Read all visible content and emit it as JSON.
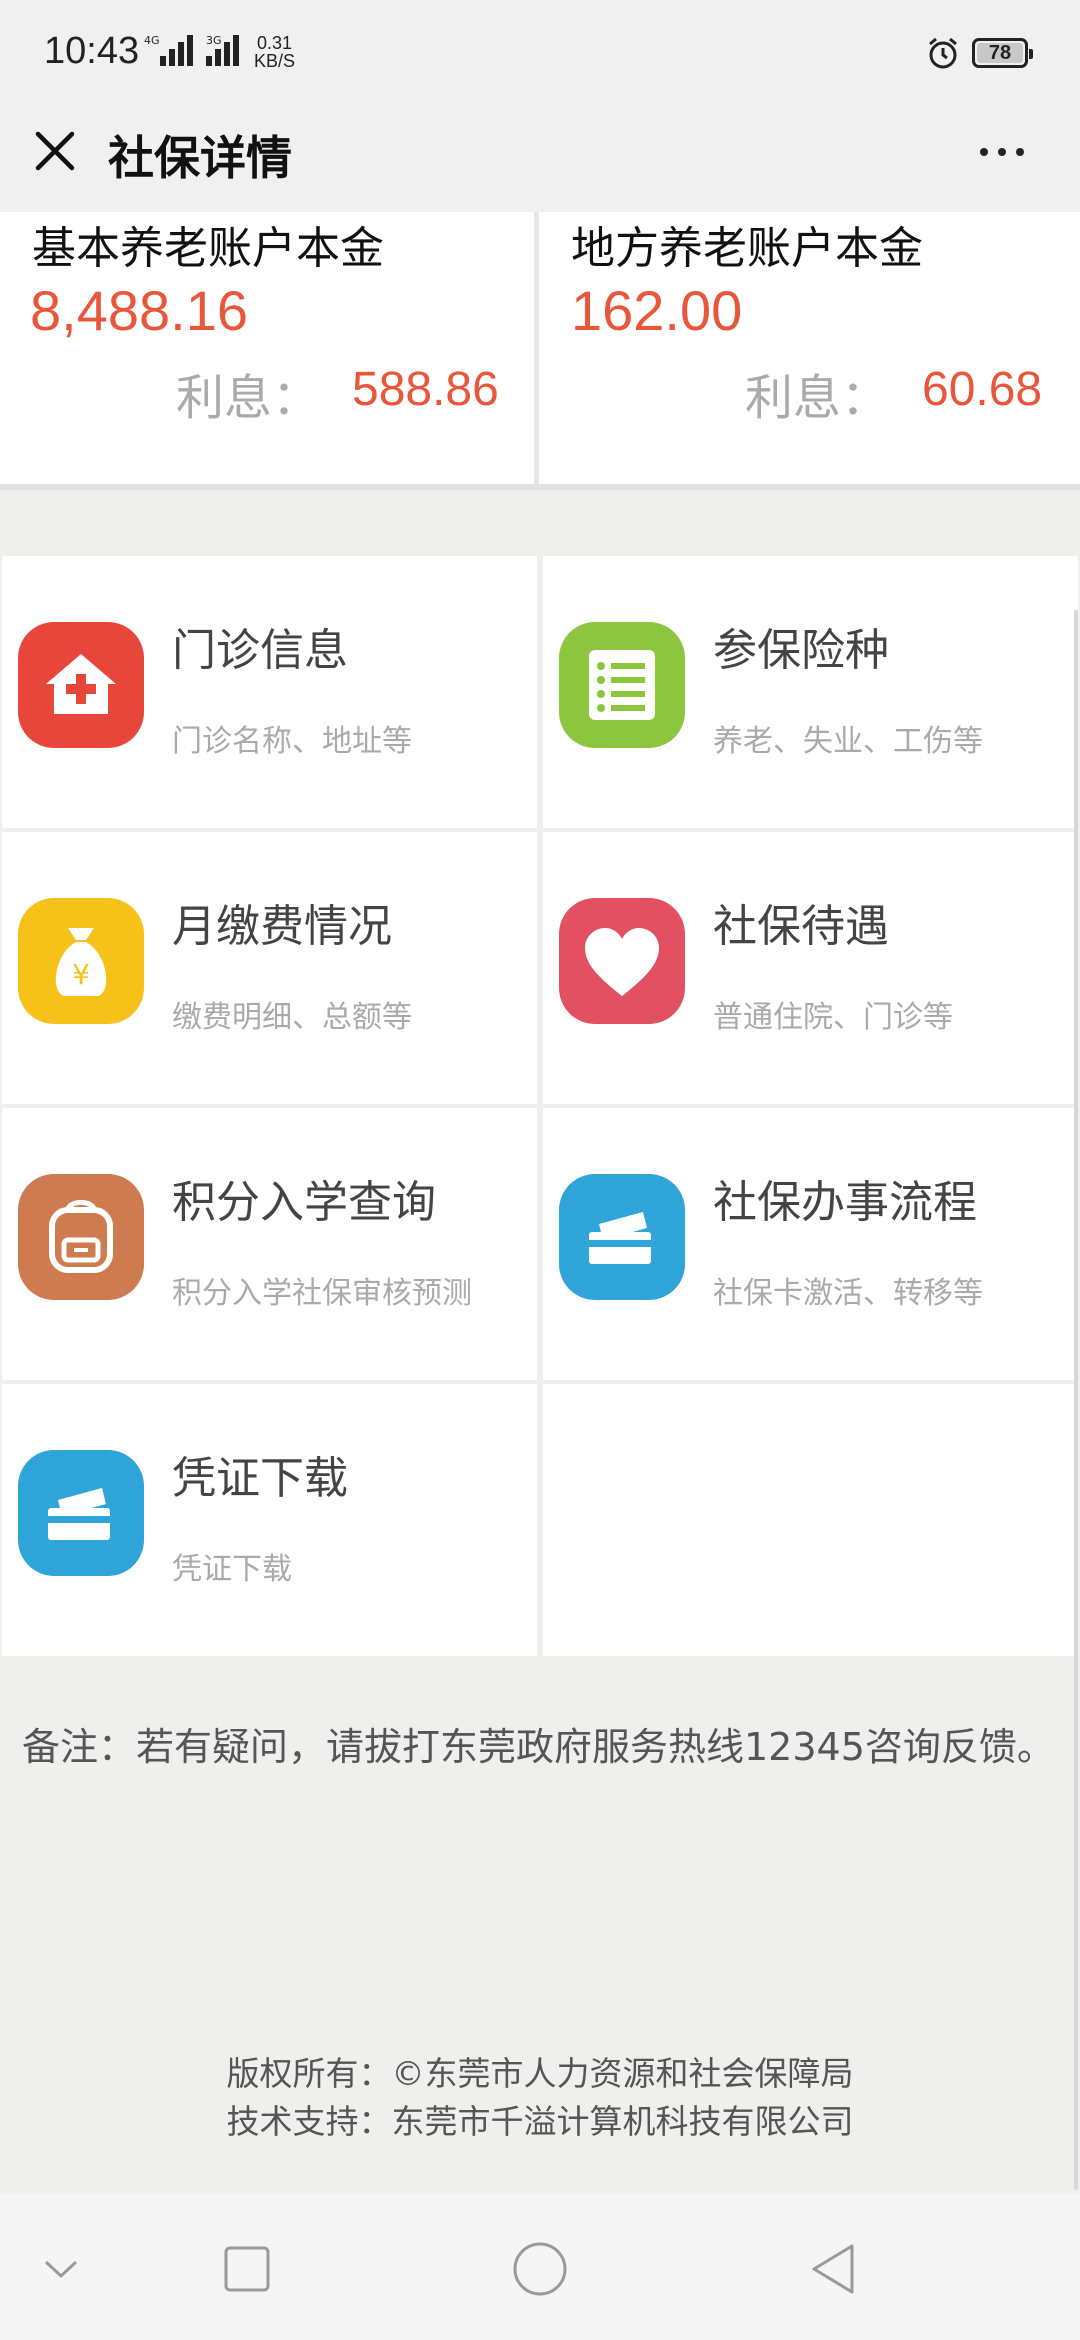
{
  "status_bar": {
    "time": "10:43",
    "signal1_label": "4G",
    "signal2_label": "3G",
    "net_speed_value": "0.31",
    "net_speed_unit": "KB/S",
    "battery": "78",
    "icons": [
      "signal-icon",
      "alarm-icon",
      "battery-icon"
    ]
  },
  "header": {
    "title": "社保详情",
    "close_icon": "close-icon",
    "more_icon": "more-icon"
  },
  "accounts": [
    {
      "title": "基本养老账户本金",
      "amount": "8,488.16",
      "interest_label": "利息：",
      "interest": "588.86"
    },
    {
      "title": "地方养老账户本金",
      "amount": "162.00",
      "interest_label": "利息：",
      "interest": "60.68"
    }
  ],
  "menu": [
    {
      "title": "门诊信息",
      "subtitle": "门诊名称、地址等",
      "icon": "clinic-icon",
      "color": "#e8453b"
    },
    {
      "title": "参保险种",
      "subtitle": "养老、失业、工伤等",
      "icon": "list-icon",
      "color": "#8cc63f"
    },
    {
      "title": "月缴费情况",
      "subtitle": "缴费明细、总额等",
      "icon": "money-bag-icon",
      "color": "#f6c21a"
    },
    {
      "title": "社保待遇",
      "subtitle": "普通住院、门诊等",
      "icon": "heart-icon",
      "color": "#e25062"
    },
    {
      "title": "积分入学查询",
      "subtitle": "积分入学社保审核预测",
      "icon": "backpack-icon",
      "color": "#cf7b50"
    },
    {
      "title": "社保办事流程",
      "subtitle": "社保卡激活、转移等",
      "icon": "card-icon",
      "color": "#2ea4d9"
    },
    {
      "title": "凭证下载",
      "subtitle": "凭证下载",
      "icon": "card-icon",
      "color": "#2ea4d9"
    }
  ],
  "note": "备注：若有疑问，请拔打东莞政府服务热线12345咨询反馈。",
  "footer": {
    "copyright": "版权所有：©东莞市人力资源和社会保障局",
    "support": "技术支持：东莞市千溢计算机科技有限公司"
  },
  "nav_bar": [
    "chevron-down-icon",
    "recent-apps-icon",
    "home-icon",
    "back-icon"
  ]
}
